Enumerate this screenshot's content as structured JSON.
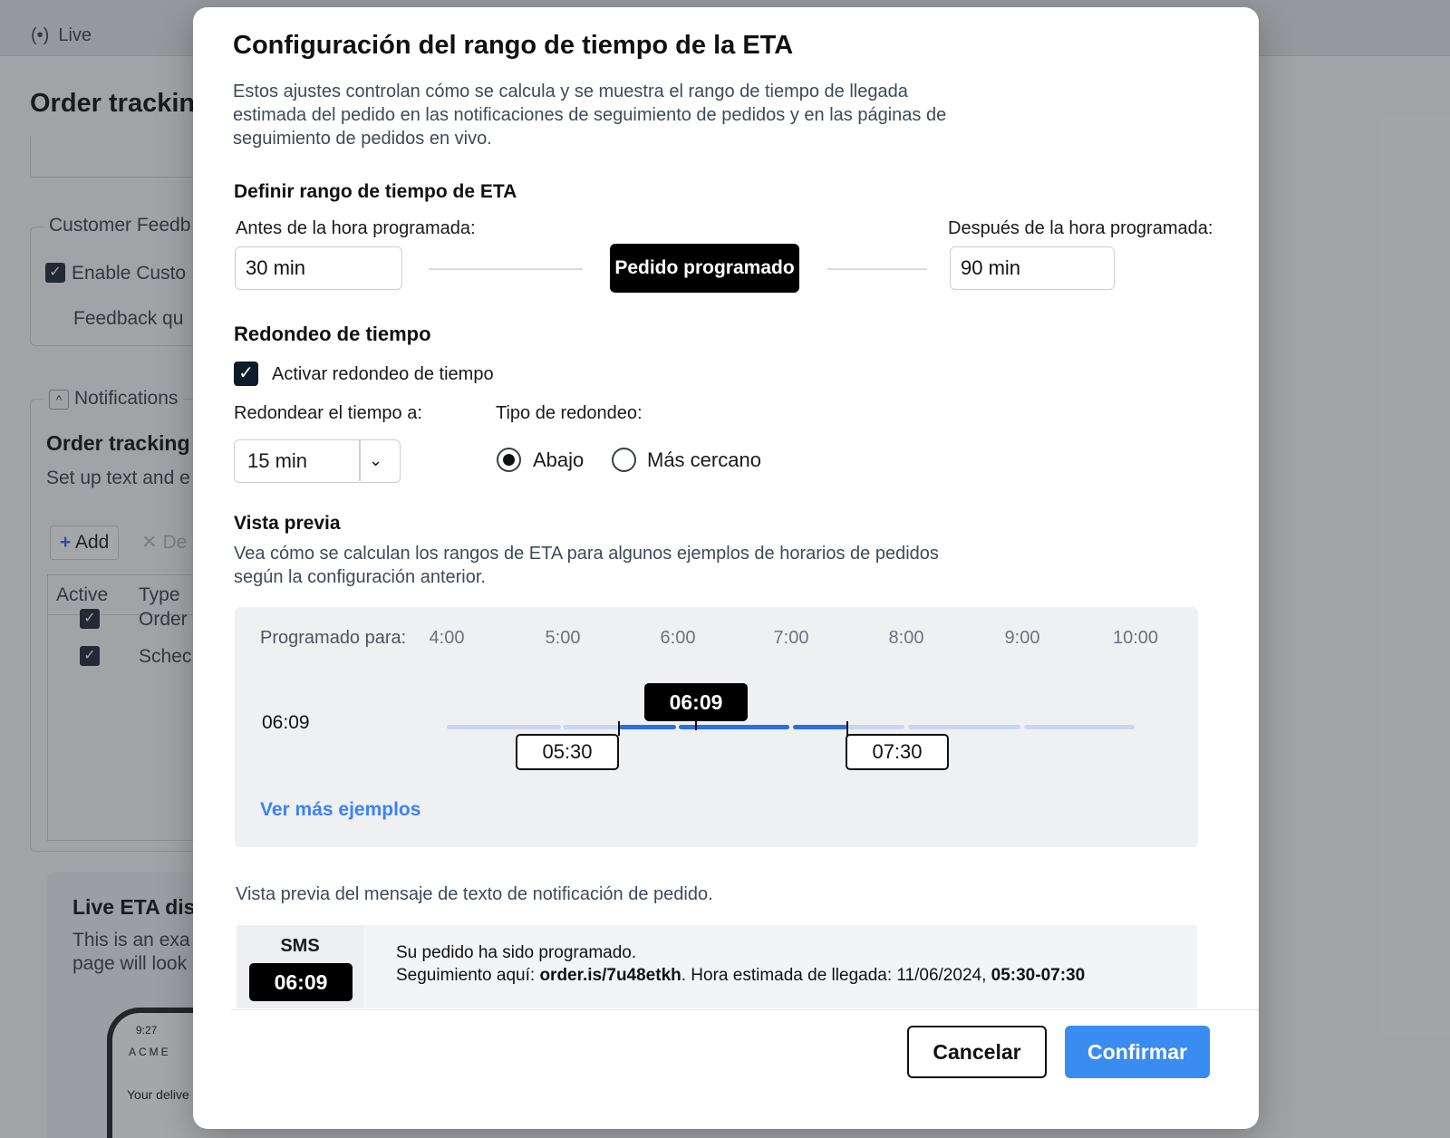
{
  "background": {
    "live_label": "Live",
    "page_title": "Order trackin",
    "customer_feedback_legend": "Customer Feedb",
    "enable_customer_label": "Enable Custo",
    "feedback_label": "Feedback qu",
    "notifications_legend": "Notifications",
    "order_tracking_heading": "Order tracking",
    "setup_text": "Set up text and e",
    "add_button": "Add",
    "delete_button": "De",
    "table_headers": [
      "Active",
      "Type"
    ],
    "table_rows": [
      "Order",
      "Schec"
    ],
    "live_eta_heading": "Live ETA dis",
    "live_eta_desc_1": "This is an exa",
    "live_eta_desc_2": "page will look",
    "phone_time": "9:27",
    "phone_brand": "ACME",
    "phone_text": "Your delive"
  },
  "modal": {
    "title": "Configuración del rango de tiempo de la ETA",
    "description": "Estos ajustes controlan cómo se calcula y se muestra el rango de tiempo de llegada estimada del pedido en las notificaciones de seguimiento de pedidos y en las páginas de seguimiento de pedidos en vivo.",
    "eta_range": {
      "heading": "Definir rango de tiempo de ETA",
      "before_label": "Antes de la hora programada:",
      "before_value": "30 min",
      "after_label": "Después de la hora programada:",
      "after_value": "90 min",
      "scheduled_pill": "Pedido programado"
    },
    "rounding": {
      "heading": "Redondeo de tiempo",
      "enable_label": "Activar redondeo de tiempo",
      "enabled": true,
      "round_to_label": "Redondear el tiempo a:",
      "round_to_value": "15 min",
      "type_label": "Tipo de redondeo:",
      "options": [
        "Abajo",
        "Más cercano"
      ],
      "selected": "Abajo"
    },
    "preview": {
      "heading": "Vista previa",
      "description": "Vea cómo se calculan los rangos de ETA para algunos ejemplos de horarios de pedidos según la configuración anterior.",
      "scheduled_label": "Programado para:",
      "ticks": [
        "4:00",
        "5:00",
        "6:00",
        "7:00",
        "8:00",
        "9:00",
        "10:00"
      ],
      "example_time": "06:09",
      "scheduled_tag": "06:09",
      "range_start": "05:30",
      "range_end": "07:30",
      "more_link": "Ver más ejemplos"
    },
    "sms": {
      "caption": "Vista previa del mensaje de texto de notificación de pedido.",
      "label": "SMS",
      "time": "06:09",
      "line1": "Su pedido ha sido programado.",
      "line2_prefix": "Seguimiento aquí: ",
      "line2_link": "order.is/7u48etkh",
      "line2_mid": ". Hora estimada de llegada: ",
      "line2_date": "11/06/2024, ",
      "line2_range": "05:30-07:30"
    },
    "buttons": {
      "cancel": "Cancelar",
      "confirm": "Confirmar"
    }
  },
  "colors": {
    "accent": "#3b8cf1",
    "range_bar": "#2d6fe0",
    "range_bar_light": "#c9d8f0"
  }
}
